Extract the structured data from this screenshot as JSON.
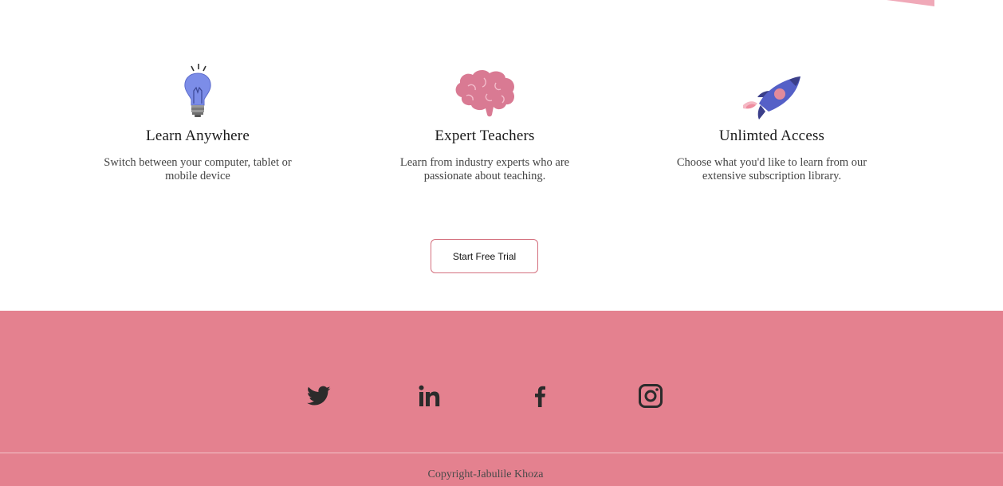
{
  "features": [
    {
      "title": "Learn Anywhere",
      "desc": "Switch between your computer, tablet or mobile device",
      "icon": "lightbulb-icon"
    },
    {
      "title": "Expert Teachers",
      "desc": "Learn from industry experts who are passionate about teaching.",
      "icon": "brain-icon"
    },
    {
      "title": "Unlimted Access",
      "desc": "Choose what you'd like to learn from our extensive subscription library.",
      "icon": "rocket-icon"
    }
  ],
  "cta": {
    "label": "Start Free Trial"
  },
  "footer": {
    "social": [
      "twitter-icon",
      "linkedin-icon",
      "facebook-icon",
      "instagram-icon"
    ],
    "copyright": "Copyright-Jabulile Khoza"
  },
  "colors": {
    "footer_bg": "#e4818f",
    "accent_pink": "#d4707e",
    "icon_dark": "#2b2b2b",
    "bulb_blue": "#7c8de8",
    "brain_pink": "#d97a93",
    "rocket_blue": "#5560c7"
  }
}
